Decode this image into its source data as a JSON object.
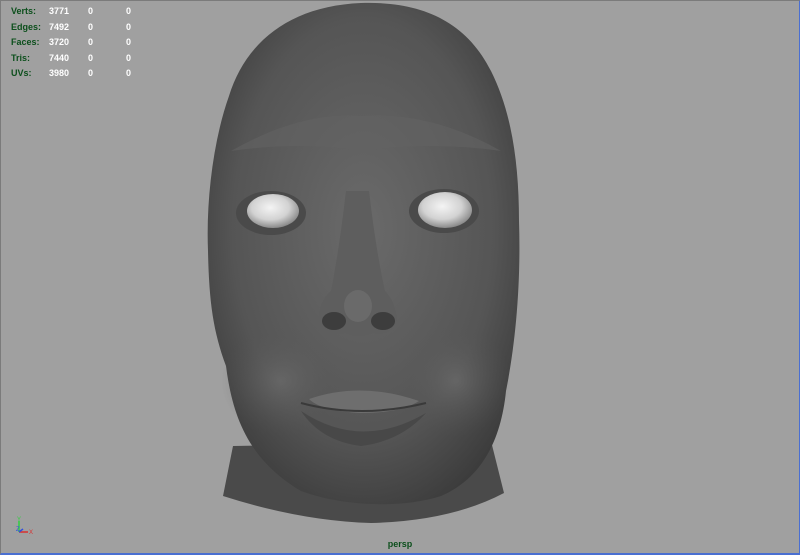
{
  "hud": {
    "rows": [
      {
        "label": "Verts:",
        "values": [
          "3771",
          "0",
          "0"
        ]
      },
      {
        "label": "Edges:",
        "values": [
          "7492",
          "0",
          "0"
        ]
      },
      {
        "label": "Faces:",
        "values": [
          "3720",
          "0",
          "0"
        ]
      },
      {
        "label": "Tris:",
        "values": [
          "7440",
          "0",
          "0"
        ]
      },
      {
        "label": "UVs:",
        "values": [
          "3980",
          "0",
          "0"
        ]
      }
    ]
  },
  "axis": {
    "y": "Y",
    "z": "Z",
    "x": "X"
  },
  "camera_label": "persp",
  "colors": {
    "background": "#a0a0a0",
    "hud_label": "#0c4f1c",
    "hud_value": "#ffffff",
    "mesh_base": "#555555",
    "selection_border": "#4a6fd1"
  }
}
